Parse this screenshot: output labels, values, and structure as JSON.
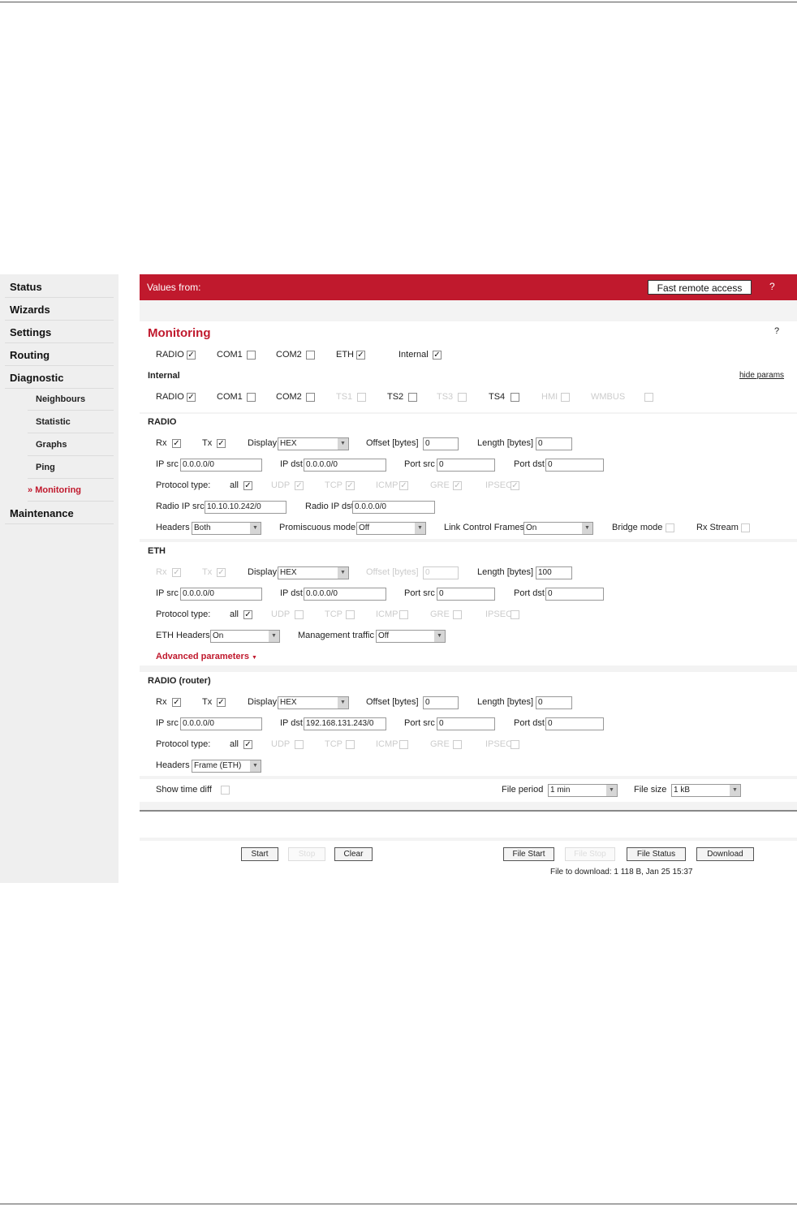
{
  "sidebar": {
    "items": [
      "Status",
      "Wizards",
      "Settings",
      "Routing",
      "Diagnostic"
    ],
    "sub_items": [
      "Neighbours",
      "Statistic",
      "Graphs",
      "Ping",
      "Monitoring"
    ],
    "active_prefix": "»",
    "last_item": "Maintenance"
  },
  "topbar": {
    "values_from": "Values from:",
    "fast_remote": "Fast remote access",
    "help": "?"
  },
  "monitoring": {
    "title": "Monitoring",
    "help": "?",
    "top_checks": {
      "radio": "RADIO",
      "com1": "COM1",
      "com2": "COM2",
      "eth": "ETH",
      "internal": "Internal"
    },
    "internal_header": "Internal",
    "hide_params": "hide params",
    "internal_checks": {
      "radio": "RADIO",
      "com1": "COM1",
      "com2": "COM2",
      "ts1": "TS1",
      "ts2": "TS2",
      "ts3": "TS3",
      "ts4": "TS4",
      "hmi": "HMI",
      "wmbus": "WMBUS"
    }
  },
  "radio": {
    "header": "RADIO",
    "rx": "Rx",
    "tx": "Tx",
    "display_label": "Display",
    "display_value": "HEX",
    "offset_label": "Offset [bytes]",
    "offset_value": "0",
    "length_label": "Length [bytes]",
    "length_value": "0",
    "ip_src_label": "IP src",
    "ip_src_value": "0.0.0.0/0",
    "ip_dst_label": "IP dst",
    "ip_dst_value": "0.0.0.0/0",
    "port_src_label": "Port src",
    "port_src_value": "0",
    "port_dst_label": "Port dst",
    "port_dst_value": "0",
    "protocol_label": "Protocol type:",
    "proto_all": "all",
    "proto_types": [
      "UDP",
      "TCP",
      "ICMP",
      "GRE",
      "IPSEC"
    ],
    "radio_ip_src_label": "Radio IP src",
    "radio_ip_src_value": "10.10.10.242/0",
    "radio_ip_dst_label": "Radio IP dst",
    "radio_ip_dst_value": "0.0.0.0/0",
    "headers_label": "Headers",
    "headers_value": "Both",
    "promisc_label": "Promiscuous mode",
    "promisc_value": "Off",
    "lcf_label": "Link Control Frames",
    "lcf_value": "On",
    "bridge_label": "Bridge mode",
    "rxstream_label": "Rx Stream"
  },
  "eth": {
    "header": "ETH",
    "rx": "Rx",
    "tx": "Tx",
    "display_label": "Display",
    "display_value": "HEX",
    "offset_label": "Offset [bytes]",
    "offset_value": "0",
    "length_label": "Length [bytes]",
    "length_value": "100",
    "ip_src_label": "IP src",
    "ip_src_value": "0.0.0.0/0",
    "ip_dst_label": "IP dst",
    "ip_dst_value": "0.0.0.0/0",
    "port_src_label": "Port src",
    "port_src_value": "0",
    "port_dst_label": "Port dst",
    "port_dst_value": "0",
    "protocol_label": "Protocol type:",
    "proto_all": "all",
    "proto_types": [
      "UDP",
      "TCP",
      "ICMP",
      "GRE",
      "IPSEC"
    ],
    "eth_headers_label": "ETH Headers",
    "eth_headers_value": "On",
    "mgmt_label": "Management traffic",
    "mgmt_value": "Off",
    "advanced": "Advanced parameters"
  },
  "radio_router": {
    "header": "RADIO (router)",
    "rx": "Rx",
    "tx": "Tx",
    "display_label": "Display",
    "display_value": "HEX",
    "offset_label": "Offset [bytes]",
    "offset_value": "0",
    "length_label": "Length [bytes]",
    "length_value": "0",
    "ip_src_label": "IP src",
    "ip_src_value": "0.0.0.0/0",
    "ip_dst_label": "IP dst",
    "ip_dst_value": "192.168.131.243/0",
    "port_src_label": "Port src",
    "port_src_value": "0",
    "port_dst_label": "Port dst",
    "port_dst_value": "0",
    "protocol_label": "Protocol type:",
    "proto_all": "all",
    "proto_types": [
      "UDP",
      "TCP",
      "ICMP",
      "GRE",
      "IPSEC"
    ],
    "headers_label": "Headers",
    "headers_value": "Frame (ETH)"
  },
  "footer": {
    "show_time_diff": "Show time diff",
    "file_period_label": "File period",
    "file_period_value": "1 min",
    "file_size_label": "File size",
    "file_size_value": "1 kB",
    "start": "Start",
    "stop": "Stop",
    "clear": "Clear",
    "file_start": "File Start",
    "file_stop": "File Stop",
    "file_status": "File Status",
    "download": "Download",
    "file_to_download": "File to download: 1 118 B, Jan 25 15:37"
  },
  "check_mark": "✓",
  "select_arrow": "▼"
}
